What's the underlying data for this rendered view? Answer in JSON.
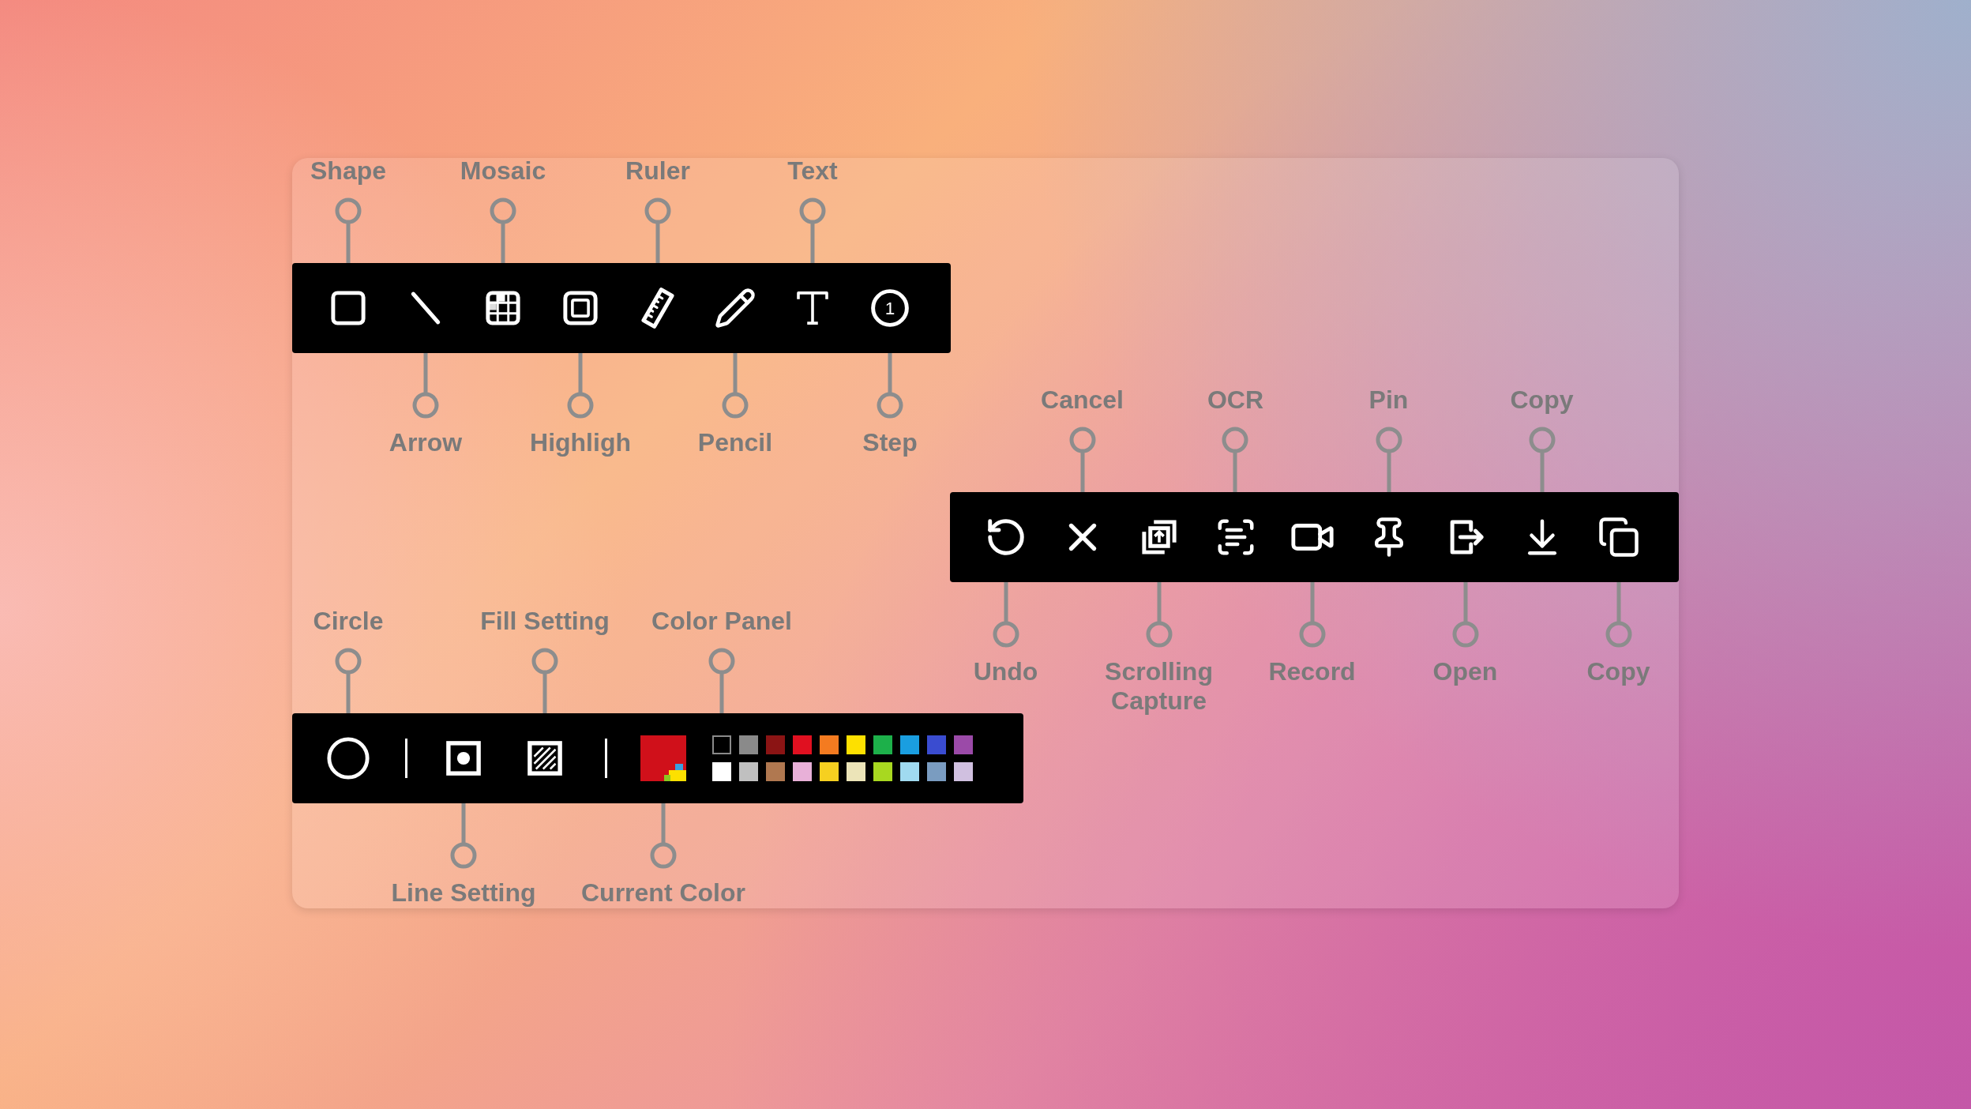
{
  "drawing_toolbar": {
    "tools": [
      {
        "top_label": "Shape"
      },
      {
        "bottom_label": "Arrow"
      },
      {
        "top_label": "Mosaic"
      },
      {
        "bottom_label": "Highligh"
      },
      {
        "top_label": "Ruler"
      },
      {
        "bottom_label": "Pencil"
      },
      {
        "top_label": "Text"
      },
      {
        "bottom_label": "Step",
        "number": "1"
      }
    ]
  },
  "action_toolbar": {
    "tools": [
      {
        "bottom_label": "Undo"
      },
      {
        "top_label": "Cancel"
      },
      {
        "bottom_label": "Scrolling\nCapture"
      },
      {
        "top_label": "OCR"
      },
      {
        "bottom_label": "Record"
      },
      {
        "top_label": "Pin"
      },
      {
        "bottom_label": "Open"
      },
      {
        "top_label": "Copy"
      },
      {
        "bottom_label": "Copy"
      }
    ]
  },
  "style_toolbar": {
    "items": [
      {
        "kind": "tool",
        "top_label": "Circle"
      },
      {
        "kind": "divider"
      },
      {
        "kind": "tool",
        "bottom_label": "Line Setting"
      },
      {
        "kind": "tool",
        "top_label": "Fill Setting"
      },
      {
        "kind": "divider"
      },
      {
        "kind": "current_color",
        "bottom_label": "Current Color",
        "color": "#d0101a"
      },
      {
        "kind": "palette",
        "top_label": "Color Panel",
        "swatches": [
          {
            "color": "#000000"
          },
          {
            "color": "#8a8a8a"
          },
          {
            "color": "#8b1414"
          },
          {
            "color": "#e01020"
          },
          {
            "color": "#f47b20"
          },
          {
            "color": "#fde000"
          },
          {
            "color": "#1db04a"
          },
          {
            "color": "#1a9ee0"
          },
          {
            "color": "#3a4cd0"
          },
          {
            "color": "#9b4aa8"
          },
          {
            "color": "#ffffff"
          },
          {
            "color": "#c0c0c0"
          },
          {
            "color": "#b07850"
          },
          {
            "color": "#e8b0d8"
          },
          {
            "color": "#f6d020"
          },
          {
            "color": "#ece4b8"
          },
          {
            "color": "#a8d820"
          },
          {
            "color": "#a0daf0"
          },
          {
            "color": "#7a9cc0"
          },
          {
            "color": "#d0c0e0"
          }
        ]
      }
    ]
  }
}
